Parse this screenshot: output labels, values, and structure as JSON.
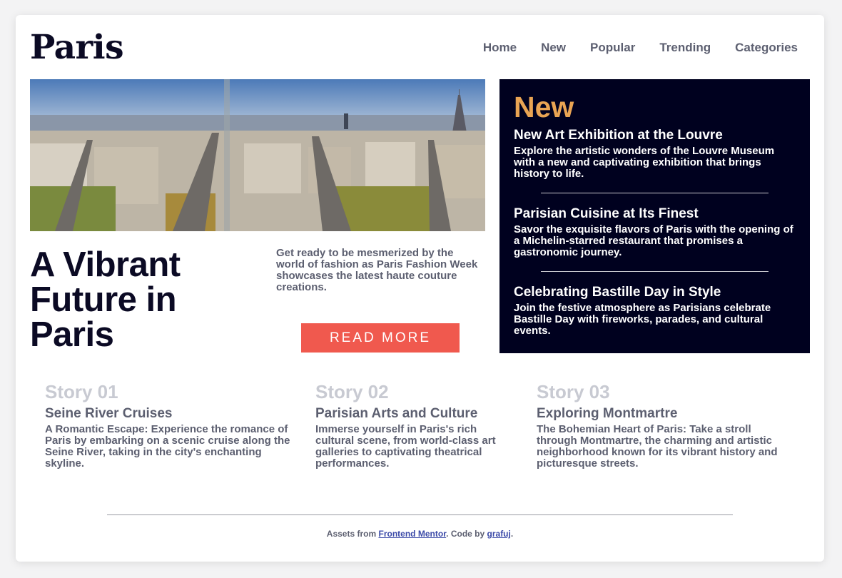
{
  "header": {
    "logo": "Paris",
    "nav": [
      "Home",
      "New",
      "Popular",
      "Trending",
      "Categories"
    ]
  },
  "hero": {
    "image_alt": "Aerial view of Paris avenues with the Eiffel Tower",
    "headline": "A Vibrant Future in Paris",
    "intro": "Get ready to be mesmerized by the world of fashion as Paris Fashion Week showcases the latest haute couture creations.",
    "button": "READ MORE"
  },
  "new_panel": {
    "title": "New",
    "items": [
      {
        "title": "New Art Exhibition at the Louvre",
        "text": "Explore the artistic wonders of the Louvre Museum with a new and captivating exhibition that brings history to life."
      },
      {
        "title": "Parisian Cuisine at Its Finest",
        "text": "Savor the exquisite flavors of Paris with the opening of a Michelin-starred restaurant that promises a gastronomic journey."
      },
      {
        "title": "Celebrating Bastille Day in Style",
        "text": "Join the festive atmosphere as Parisians celebrate Bastille Day with fireworks, parades, and cultural events."
      }
    ]
  },
  "stories": [
    {
      "number": "Story 01",
      "title": "Seine River Cruises",
      "text": "A Romantic Escape: Experience the romance of Paris by embarking on a scenic cruise along the Seine River, taking in the city's enchanting skyline."
    },
    {
      "number": "Story 02",
      "title": "Parisian Arts and Culture",
      "text": "Immerse yourself in Paris's rich cultural scene, from world-class art galleries to captivating theatrical performances."
    },
    {
      "number": "Story 03",
      "title": "Exploring Montmartre",
      "text": "The Bohemian Heart of Paris: Take a stroll through Montmartre, the charming and artistic neighborhood known for its vibrant history and picturesque streets."
    }
  ],
  "footer": {
    "prefix": "Assets from ",
    "link1": "Frontend Mentor",
    "middle": ". Code by ",
    "link2": "grafuj",
    "suffix": "."
  },
  "colors": {
    "accent": "#f0594e",
    "new_title": "#e9a453",
    "panel_bg": "#00011f",
    "dark_text": "#0b0a24",
    "muted_text": "#5c5f70"
  }
}
